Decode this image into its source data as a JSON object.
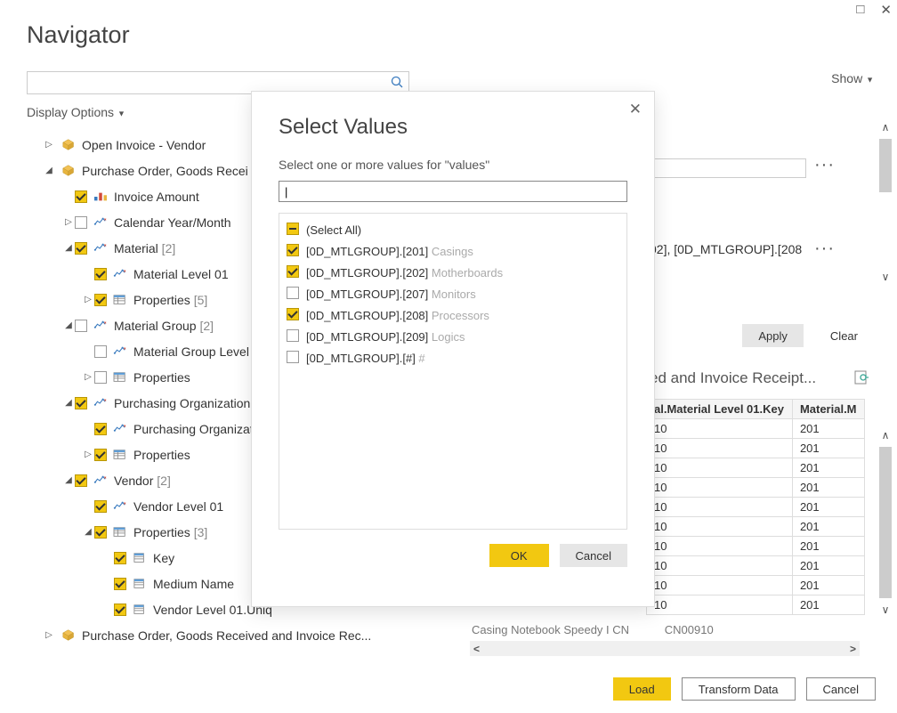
{
  "window": {
    "title": "Navigator",
    "display_options": "Display Options",
    "show": "Show"
  },
  "tree": [
    {
      "indent": 0,
      "arrow": "▷",
      "icon": "cube",
      "label": "Open Invoice - Vendor"
    },
    {
      "indent": 0,
      "arrow": "▲",
      "icon": "cube",
      "label": "Purchase Order, Goods Recei"
    },
    {
      "indent": 1,
      "arrow": "",
      "cb": "checked",
      "icon": "kf",
      "label": "Invoice Amount"
    },
    {
      "indent": 1,
      "arrow": "▷",
      "cb": "unchecked",
      "icon": "hier",
      "label": "Calendar Year/Month"
    },
    {
      "indent": 1,
      "arrow": "▲",
      "cb": "checked",
      "icon": "hier",
      "label": "Material",
      "note": "[2]"
    },
    {
      "indent": 2,
      "arrow": "",
      "cb": "checked",
      "icon": "hier",
      "label": "Material Level 01"
    },
    {
      "indent": 2,
      "arrow": "▷",
      "cb": "checked",
      "icon": "prop",
      "label": "Properties",
      "note": "[5]"
    },
    {
      "indent": 1,
      "arrow": "▲",
      "cb": "unchecked",
      "icon": "hier",
      "label": "Material Group",
      "note": "[2]"
    },
    {
      "indent": 2,
      "arrow": "",
      "cb": "unchecked",
      "icon": "hier",
      "label": "Material Group Level 0"
    },
    {
      "indent": 2,
      "arrow": "▷",
      "cb": "unchecked",
      "icon": "prop",
      "label": "Properties"
    },
    {
      "indent": 1,
      "arrow": "▲",
      "cb": "checked",
      "icon": "hier",
      "label": "Purchasing Organization"
    },
    {
      "indent": 2,
      "arrow": "",
      "cb": "checked",
      "icon": "hier",
      "label": "Purchasing Organizatio"
    },
    {
      "indent": 2,
      "arrow": "▷",
      "cb": "checked",
      "icon": "prop",
      "label": "Properties"
    },
    {
      "indent": 1,
      "arrow": "▲",
      "cb": "checked",
      "icon": "hier",
      "label": "Vendor",
      "note": "[2]"
    },
    {
      "indent": 2,
      "arrow": "",
      "cb": "checked",
      "icon": "hier",
      "label": "Vendor Level 01"
    },
    {
      "indent": 2,
      "arrow": "▲",
      "cb": "checked",
      "icon": "prop",
      "label": "Properties",
      "note": "[3]"
    },
    {
      "indent": 3,
      "arrow": "",
      "cb": "checked",
      "icon": "col",
      "label": "Key"
    },
    {
      "indent": 3,
      "arrow": "",
      "cb": "checked",
      "icon": "col",
      "label": "Medium Name"
    },
    {
      "indent": 3,
      "arrow": "",
      "cb": "checked",
      "icon": "col",
      "label": "Vendor Level 01.Uniq"
    },
    {
      "indent": 0,
      "arrow": "▷",
      "icon": "cube",
      "label": "Purchase Order, Goods Received and Invoice Rec..."
    }
  ],
  "right": {
    "value_text": "02], [0D_MTLGROUP].[208",
    "apply": "Apply",
    "clear": "Clear",
    "preview_title": "ed and Invoice Receipt...",
    "col1": "al.Material Level 01.Key",
    "col2": "Material.M",
    "rows_key": [
      "10",
      "10",
      "10",
      "10",
      "10",
      "10",
      "10",
      "10",
      "10",
      "10"
    ],
    "rows_val": [
      "201",
      "201",
      "201",
      "201",
      "201",
      "201",
      "201",
      "201",
      "201",
      "201"
    ],
    "under_text": "Casing Notebook Speedy I CN"
  },
  "modal": {
    "title": "Select Values",
    "prompt": "Select one or more values for \"values\"",
    "select_all": "(Select All)",
    "items": [
      {
        "checked": true,
        "code": "[0D_MTLGROUP].[201]",
        "desc": "Casings"
      },
      {
        "checked": true,
        "code": "[0D_MTLGROUP].[202]",
        "desc": "Motherboards"
      },
      {
        "checked": false,
        "code": "[0D_MTLGROUP].[207]",
        "desc": "Monitors"
      },
      {
        "checked": true,
        "code": "[0D_MTLGROUP].[208]",
        "desc": "Processors"
      },
      {
        "checked": false,
        "code": "[0D_MTLGROUP].[209]",
        "desc": "Logics"
      },
      {
        "checked": false,
        "code": "[0D_MTLGROUP].[#]",
        "desc": "#"
      }
    ],
    "ok": "OK",
    "cancel": "Cancel"
  },
  "footer": {
    "load": "Load",
    "transform": "Transform Data",
    "cancel": "Cancel"
  }
}
